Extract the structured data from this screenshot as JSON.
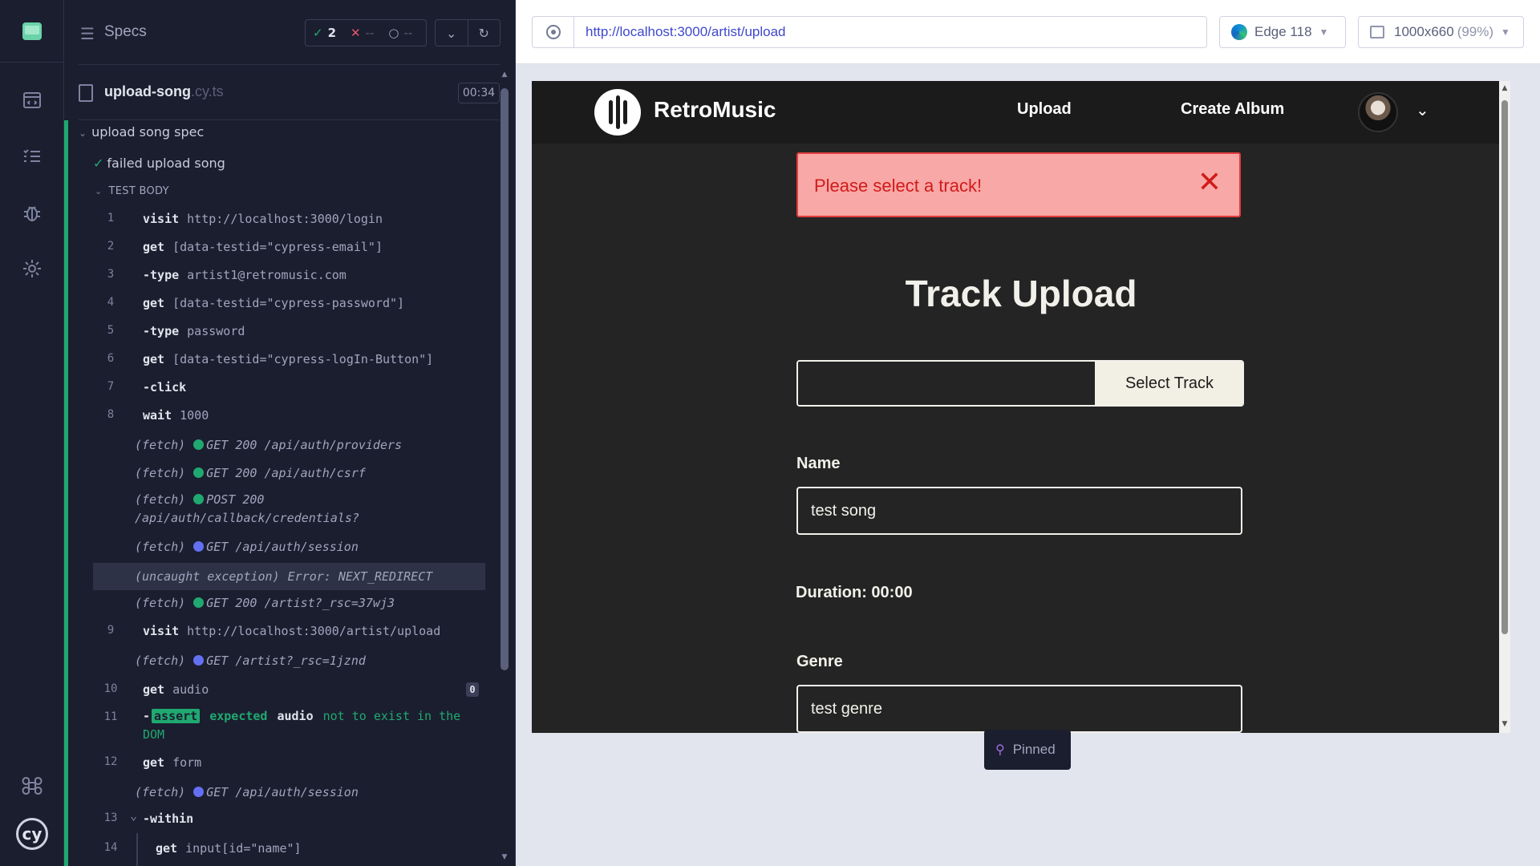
{
  "reporter": {
    "specs_label": "Specs",
    "stats": {
      "passed": "2",
      "failed": "--",
      "pending": "--"
    },
    "spec_file": {
      "name": "upload-song",
      "ext": ".cy.ts",
      "duration": "00:34"
    },
    "suite_title": "upload song spec",
    "test_title": "failed upload song",
    "test_body_label": "TEST BODY",
    "commands": [
      {
        "num": "1",
        "name": "visit",
        "arg": "http://localhost:3000/login"
      },
      {
        "num": "2",
        "name": "get",
        "arg": "[data-testid=\"cypress-email\"]"
      },
      {
        "num": "3",
        "name": "-type",
        "arg": "artist1@retromusic.com"
      },
      {
        "num": "4",
        "name": "get",
        "arg": "[data-testid=\"cypress-password\"]"
      },
      {
        "num": "5",
        "name": "-type",
        "arg": "password"
      },
      {
        "num": "6",
        "name": "get",
        "arg": "[data-testid=\"cypress-logIn-Button\"]"
      },
      {
        "num": "7",
        "name": "-click",
        "arg": ""
      },
      {
        "num": "8",
        "name": "wait",
        "arg": "1000"
      },
      {
        "num": "",
        "name": "(fetch)",
        "arg": "GET 200 /api/auth/providers",
        "dot": "green"
      },
      {
        "num": "",
        "name": "(fetch)",
        "arg": "GET 200 /api/auth/csrf",
        "dot": "green"
      },
      {
        "num": "",
        "name": "(fetch)",
        "arg": "POST 200",
        "arg2": "/api/auth/callback/credentials?",
        "dot": "green"
      },
      {
        "num": "",
        "name": "(fetch)",
        "arg": "GET /api/auth/session",
        "dot": "blue"
      },
      {
        "num": "",
        "name": "(uncaught exception)",
        "arg": "Error: NEXT_REDIRECT"
      },
      {
        "num": "",
        "name": "(fetch)",
        "arg": "GET 200 /artist?_rsc=37wj3",
        "dot": "green"
      },
      {
        "num": "9",
        "name": "visit",
        "arg": "http://localhost:3000/artist/upload"
      },
      {
        "num": "",
        "name": "(fetch)",
        "arg": "GET /artist?_rsc=1jznd",
        "dot": "blue"
      },
      {
        "num": "10",
        "name": "get",
        "arg": "audio",
        "badge": "0"
      },
      {
        "num": "11",
        "name": "-",
        "tag": "assert",
        "expected": "expected",
        "subject": "audio",
        "rest": "not to exist in the",
        "rest2": "DOM"
      },
      {
        "num": "12",
        "name": "get",
        "arg": "form"
      },
      {
        "num": "",
        "name": "(fetch)",
        "arg": "GET /api/auth/session",
        "dot": "blue"
      },
      {
        "num": "13",
        "name": "-within",
        "arg": ""
      },
      {
        "num": "14",
        "name": "get",
        "arg": "input[id=\"name\"]"
      }
    ]
  },
  "browser": {
    "url": "http://localhost:3000/artist/upload",
    "browser_name": "Edge 118",
    "viewport": "1000x660",
    "viewport_scale": "(99%)",
    "pinned_label": "Pinned"
  },
  "app": {
    "brand": "RetroMusic",
    "nav": {
      "upload": "Upload",
      "create_album": "Create Album"
    },
    "alert": {
      "message": "Please select a track!",
      "close": "✕"
    },
    "title": "Track Upload",
    "select_track_label": "Select Track",
    "name_label": "Name",
    "name_value": "test song",
    "duration_text": "Duration: 00:00",
    "genre_label": "Genre",
    "genre_value": "test genre"
  },
  "colors": {
    "pass": "#1fa971",
    "fail": "#e45770",
    "alert_bg": "#f8a8a6",
    "alert_text": "#d01b1b",
    "app_bg": "#242424"
  },
  "icons": [
    "cypress-logo-icon",
    "runs-icon",
    "list-icon",
    "bug-icon",
    "settings-icon",
    "keyboard-shortcut-icon",
    "file-icon",
    "chevron-down-icon",
    "refresh-icon",
    "target-icon",
    "edge-browser-icon",
    "viewport-icon",
    "pin-icon",
    "close-icon"
  ]
}
